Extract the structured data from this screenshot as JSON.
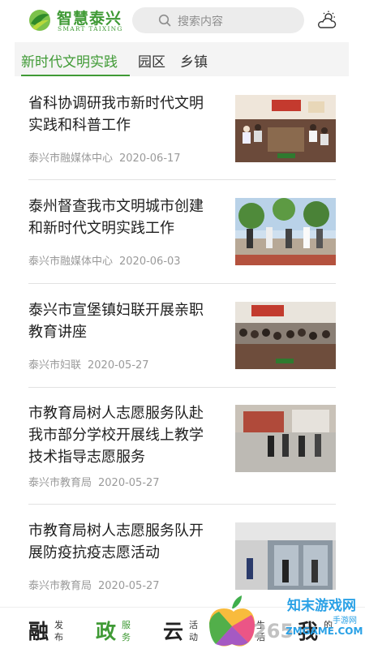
{
  "header": {
    "logo_cn": "智慧泰兴",
    "logo_en": "SMART TAIXING",
    "search_placeholder": "搜索内容",
    "weather_icon": "cloud-sun-icon",
    "search_icon": "search-icon"
  },
  "tabs": [
    {
      "label": "新时代文明实践",
      "active": true
    },
    {
      "label": "园区",
      "active": false
    },
    {
      "label": "乡镇",
      "active": false
    }
  ],
  "news": [
    {
      "title": "省科协调研我市新时代文明实践和科普工作",
      "source": "泰兴市融媒体中心",
      "date": "2020-06-17"
    },
    {
      "title": "泰州督查我市文明城市创建和新时代文明实践工作",
      "source": "泰兴市融媒体中心",
      "date": "2020-06-03"
    },
    {
      "title": "泰兴市宣堡镇妇联开展亲职教育讲座",
      "source": "泰兴市妇联",
      "date": "2020-05-27"
    },
    {
      "title": "市教育局树人志愿服务队赴我市部分学校开展线上教学技术指导志愿服务",
      "source": "泰兴市教育局",
      "date": "2020-05-27"
    },
    {
      "title": "市教育局树人志愿服务队开展防疫抗疫志愿活动",
      "source": "泰兴市教育局",
      "date": "2020-05-27"
    }
  ],
  "bottom_nav": [
    {
      "big": "融",
      "small": "发布",
      "active": false
    },
    {
      "big": "政",
      "small": "服务",
      "active": true
    },
    {
      "big": "云",
      "small": "活动",
      "active": false
    },
    {
      "big": "",
      "small": "生活",
      "active": false
    },
    {
      "big": "我",
      "small": "的",
      "active": false
    }
  ],
  "watermark": {
    "text_cn": "知末游戏网",
    "text_small": "手游网",
    "text_url": "ZMGAME.COM",
    "text_num": "265"
  },
  "colors": {
    "brand_green": "#3f9a35",
    "tab_bg": "#f4f4f4",
    "search_bg": "#ececec",
    "meta_gray": "#9a9a9a"
  }
}
